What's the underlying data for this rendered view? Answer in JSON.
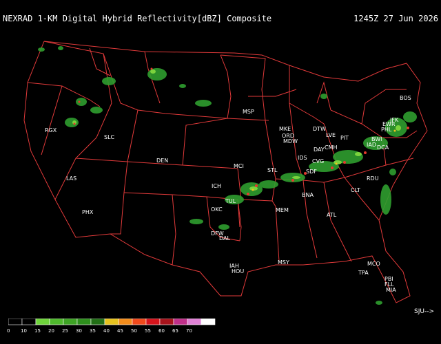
{
  "header": {
    "title": "NEXRAD 1-KM Digital Hybrid Reflectivity[dBZ] Composite",
    "timestamp": "1245Z 27 Jun 2026"
  },
  "nav": {
    "label": "SJU-->"
  },
  "colors": {
    "background": "#000000",
    "borders": "#e23a3a",
    "light_echo": "#2f9e2f",
    "moderate_echo": "#7bd33d",
    "heavy_echo": "#e43a2e",
    "text": "#ffffff"
  },
  "cities": [
    "BOS",
    "JFK",
    "EWR",
    "PHL",
    "BWI",
    "IAD",
    "DCA",
    "PIT",
    "LVE",
    "DTW",
    "MKE",
    "ORD",
    "MDW",
    "IDS",
    "DAY",
    "CMH",
    "CVG",
    "SDF",
    "STL",
    "MCI",
    "MSP",
    "DEN",
    "SLC",
    "RGX",
    "LAS",
    "PHX",
    "ICH",
    "TUL",
    "OKC",
    "DFW",
    "DAL",
    "IAH",
    "HOU",
    "MSY",
    "ATL",
    "MEM",
    "BNA",
    "CLT",
    "RDU",
    "MCO",
    "TPA",
    "PBI",
    "FLL",
    "MIA"
  ],
  "legend": {
    "items": [
      {
        "value": "0",
        "color": "#000000"
      },
      {
        "value": "10",
        "color": "#000000"
      },
      {
        "value": "15",
        "color": "#6ed33b"
      },
      {
        "value": "20",
        "color": "#4fb82d"
      },
      {
        "value": "25",
        "color": "#3ea325"
      },
      {
        "value": "30",
        "color": "#2e8f1d"
      },
      {
        "value": "35",
        "color": "#226f16"
      },
      {
        "value": "40",
        "color": "#e6c21f"
      },
      {
        "value": "45",
        "color": "#f28c1c"
      },
      {
        "value": "50",
        "color": "#f04a1c"
      },
      {
        "value": "55",
        "color": "#d6141c"
      },
      {
        "value": "60",
        "color": "#a8141c"
      },
      {
        "value": "65",
        "color": "#c0308a"
      },
      {
        "value": "70",
        "color": "#e082d6"
      },
      {
        "value": "",
        "color": "#ffffff"
      }
    ]
  }
}
